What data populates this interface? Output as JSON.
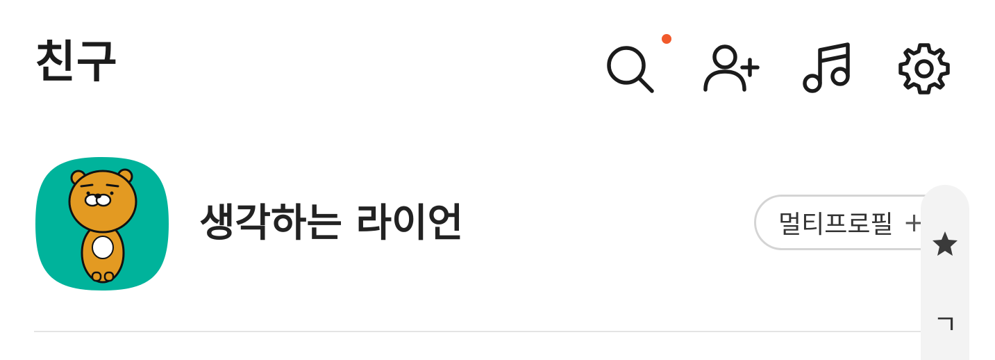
{
  "header": {
    "title": "친구",
    "icons": [
      "search-icon",
      "add-friend-icon",
      "music-icon",
      "settings-icon"
    ],
    "notification_dot_color": "#f15a2b"
  },
  "profile": {
    "name": "생각하는 라이언",
    "avatar": "ryan-character-avatar",
    "avatar_bg_color": "#00b39b",
    "multi_profile_label": "멀티프로필",
    "multi_profile_plus": "+"
  },
  "index_scroller": {
    "items": [
      "star-icon",
      "ㄱ"
    ],
    "letter": "ㄱ"
  }
}
